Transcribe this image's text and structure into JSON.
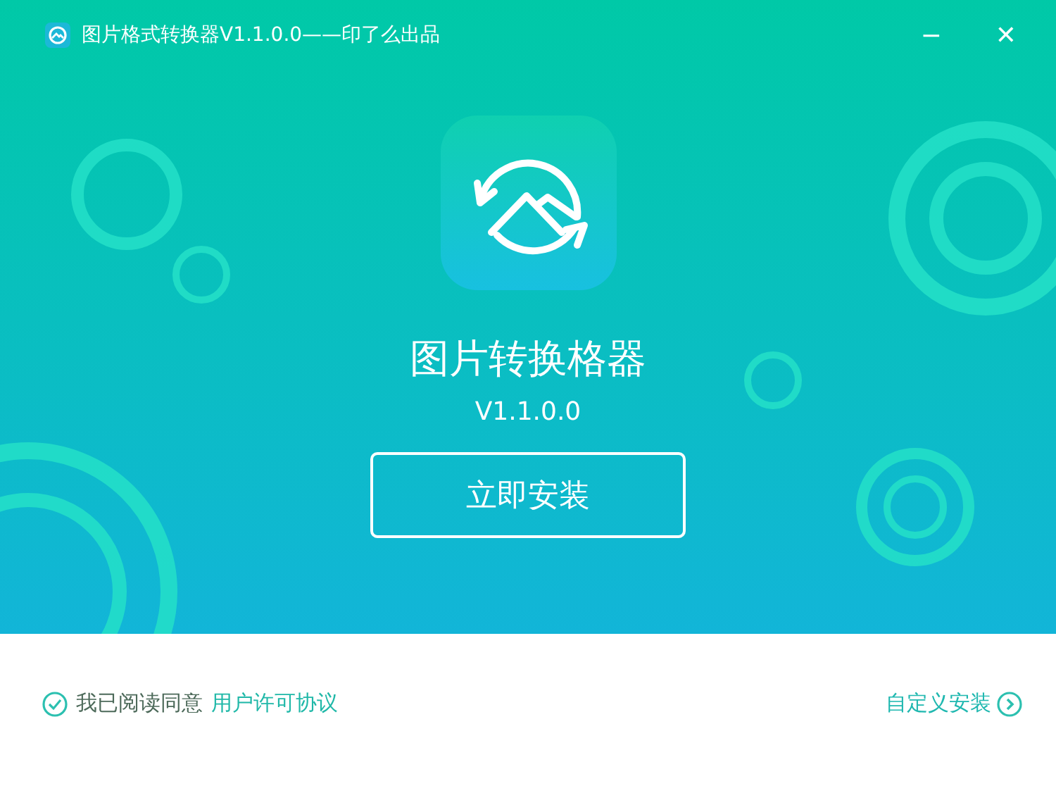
{
  "window": {
    "title": "图片格式转换器V1.1.0.0——印了么出品",
    "controls": [
      "−",
      "✕"
    ]
  },
  "hero": {
    "app_name": "图片转换格器",
    "version": "V1.1.0.0",
    "install_button": "立即安装"
  },
  "footer": {
    "agreement": {
      "checked": true,
      "text": "我已阅读同意",
      "link": "用户许可协议"
    },
    "custom_install": "自定义安装"
  }
}
